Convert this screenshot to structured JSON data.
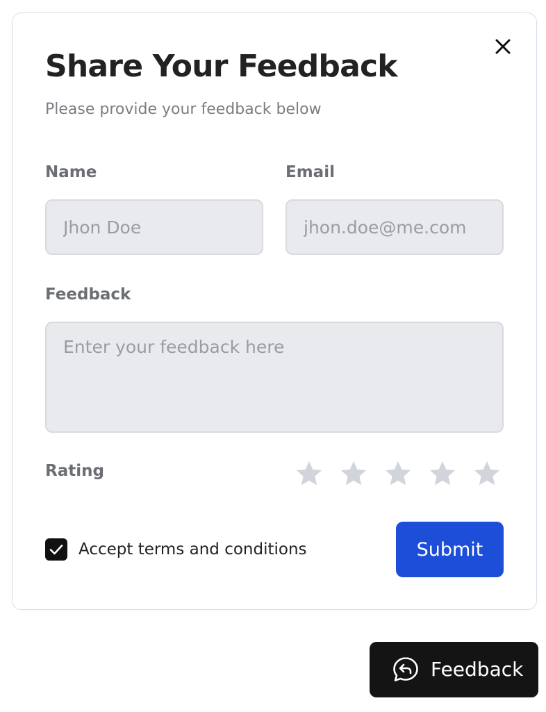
{
  "dialog": {
    "title": "Share Your Feedback",
    "subtitle": "Please provide your feedback below"
  },
  "form": {
    "name": {
      "label": "Name",
      "placeholder": "Jhon Doe",
      "value": ""
    },
    "email": {
      "label": "Email",
      "placeholder": "jhon.doe@me.com",
      "value": ""
    },
    "feedback": {
      "label": "Feedback",
      "placeholder": "Enter your feedback here",
      "value": ""
    },
    "rating": {
      "label": "Rating",
      "max": 5,
      "value": 0
    },
    "terms": {
      "label": "Accept terms and conditions",
      "checked": true
    },
    "submit_label": "Submit"
  },
  "fab": {
    "label": "Feedback",
    "icon": "chat-reply-icon"
  },
  "colors": {
    "primary": "#1d4ed8",
    "dark": "#141414",
    "star_inactive": "#d1d5db",
    "input_bg": "#e9eaed"
  }
}
